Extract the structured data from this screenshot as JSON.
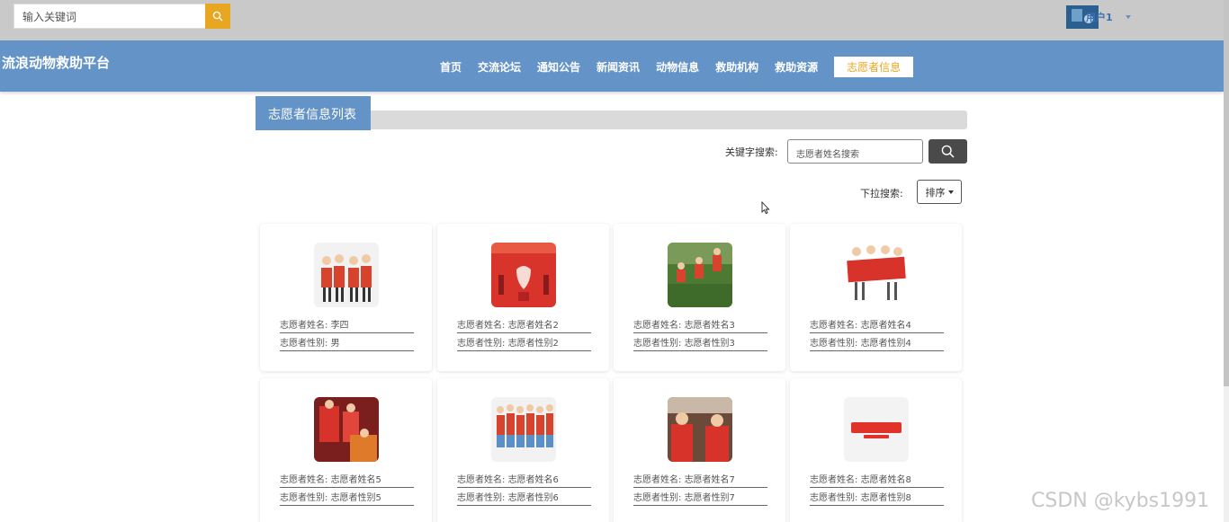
{
  "topbar": {
    "search_placeholder": "输入关键词",
    "user_name": "用户1"
  },
  "navbar": {
    "site_title": "流浪动物救助平台",
    "items": [
      {
        "label": "首页"
      },
      {
        "label": "交流论坛"
      },
      {
        "label": "通知公告"
      },
      {
        "label": "新闻资讯"
      },
      {
        "label": "动物信息"
      },
      {
        "label": "救助机构"
      },
      {
        "label": "救助资源"
      },
      {
        "label": "志愿者信息"
      }
    ],
    "active_index": 7
  },
  "section": {
    "title": "志愿者信息列表"
  },
  "search": {
    "keyword_label": "关键字搜索:",
    "keyword_placeholder": "志愿者姓名搜索",
    "dropdown_label": "下拉搜索:",
    "sort_label": "排序"
  },
  "cards": [
    {
      "name_label": "志愿者姓名:",
      "name": "李四",
      "gender_label": "志愿者性别:",
      "gender": "男"
    },
    {
      "name_label": "志愿者姓名:",
      "name": "志愿者姓名2",
      "gender_label": "志愿者性别:",
      "gender": "志愿者性别2"
    },
    {
      "name_label": "志愿者姓名:",
      "name": "志愿者姓名3",
      "gender_label": "志愿者性别:",
      "gender": "志愿者性别3"
    },
    {
      "name_label": "志愿者姓名:",
      "name": "志愿者姓名4",
      "gender_label": "志愿者性别:",
      "gender": "志愿者性别4"
    },
    {
      "name_label": "志愿者姓名:",
      "name": "志愿者姓名5",
      "gender_label": "志愿者性别:",
      "gender": "志愿者性别5"
    },
    {
      "name_label": "志愿者姓名:",
      "name": "志愿者姓名6",
      "gender_label": "志愿者性别:",
      "gender": "志愿者性别6"
    },
    {
      "name_label": "志愿者姓名:",
      "name": "志愿者姓名7",
      "gender_label": "志愿者性别:",
      "gender": "志愿者性别7"
    },
    {
      "name_label": "志愿者姓名:",
      "name": "志愿者姓名8",
      "gender_label": "志愿者性别:",
      "gender": "志愿者性别8"
    }
  ],
  "watermark": "CSDN @kybs1991",
  "colors": {
    "nav_blue": "#6493c7",
    "accent_orange": "#e8a722",
    "topbar_gray": "#c9c9c9"
  }
}
